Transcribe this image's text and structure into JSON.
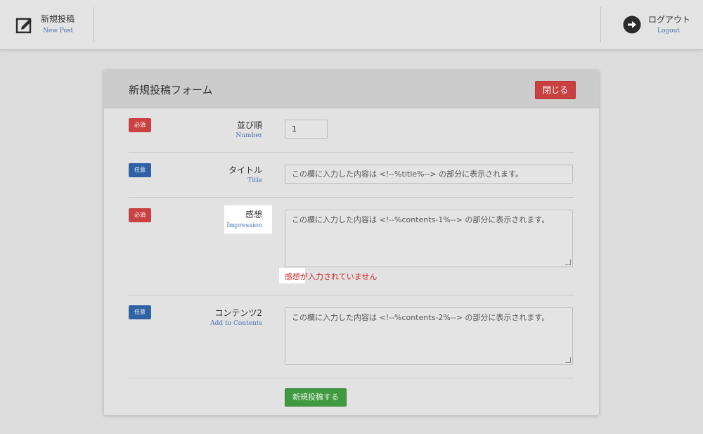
{
  "header": {
    "new_post": {
      "label": "新規投稿",
      "sublabel": "New Post",
      "icon": "edit-icon"
    },
    "logout": {
      "label": "ログアウト",
      "sublabel": "Logout",
      "icon": "arrow-right-circle-icon"
    }
  },
  "panel": {
    "title": "新規投稿フォーム",
    "close_label": "閉じる",
    "submit_label": "新規投稿する"
  },
  "fields": [
    {
      "badge": "必須",
      "label": "並び順",
      "sublabel": "Number",
      "value": "1"
    },
    {
      "badge": "任意",
      "label": "タイトル",
      "sublabel": "Title",
      "placeholder": "この欄に入力した内容は <!--%title%--> の部分に表示されます。"
    },
    {
      "badge": "必須",
      "label": "感想",
      "sublabel": "Impression",
      "placeholder": "この欄に入力した内容は <!--%contents-1%--> の部分に表示されます。",
      "error": "感想が入力されていません"
    },
    {
      "badge": "任意",
      "label": "コンテンツ2",
      "sublabel": "Add to Contents",
      "placeholder": "この欄に入力した内容は <!--%contents-2%--> の部分に表示されます。"
    }
  ],
  "colors": {
    "required": "#c94141",
    "optional": "#2f62a4",
    "submit": "#3f9a3f",
    "link": "#4a6fb3",
    "error": "#cc2222"
  }
}
